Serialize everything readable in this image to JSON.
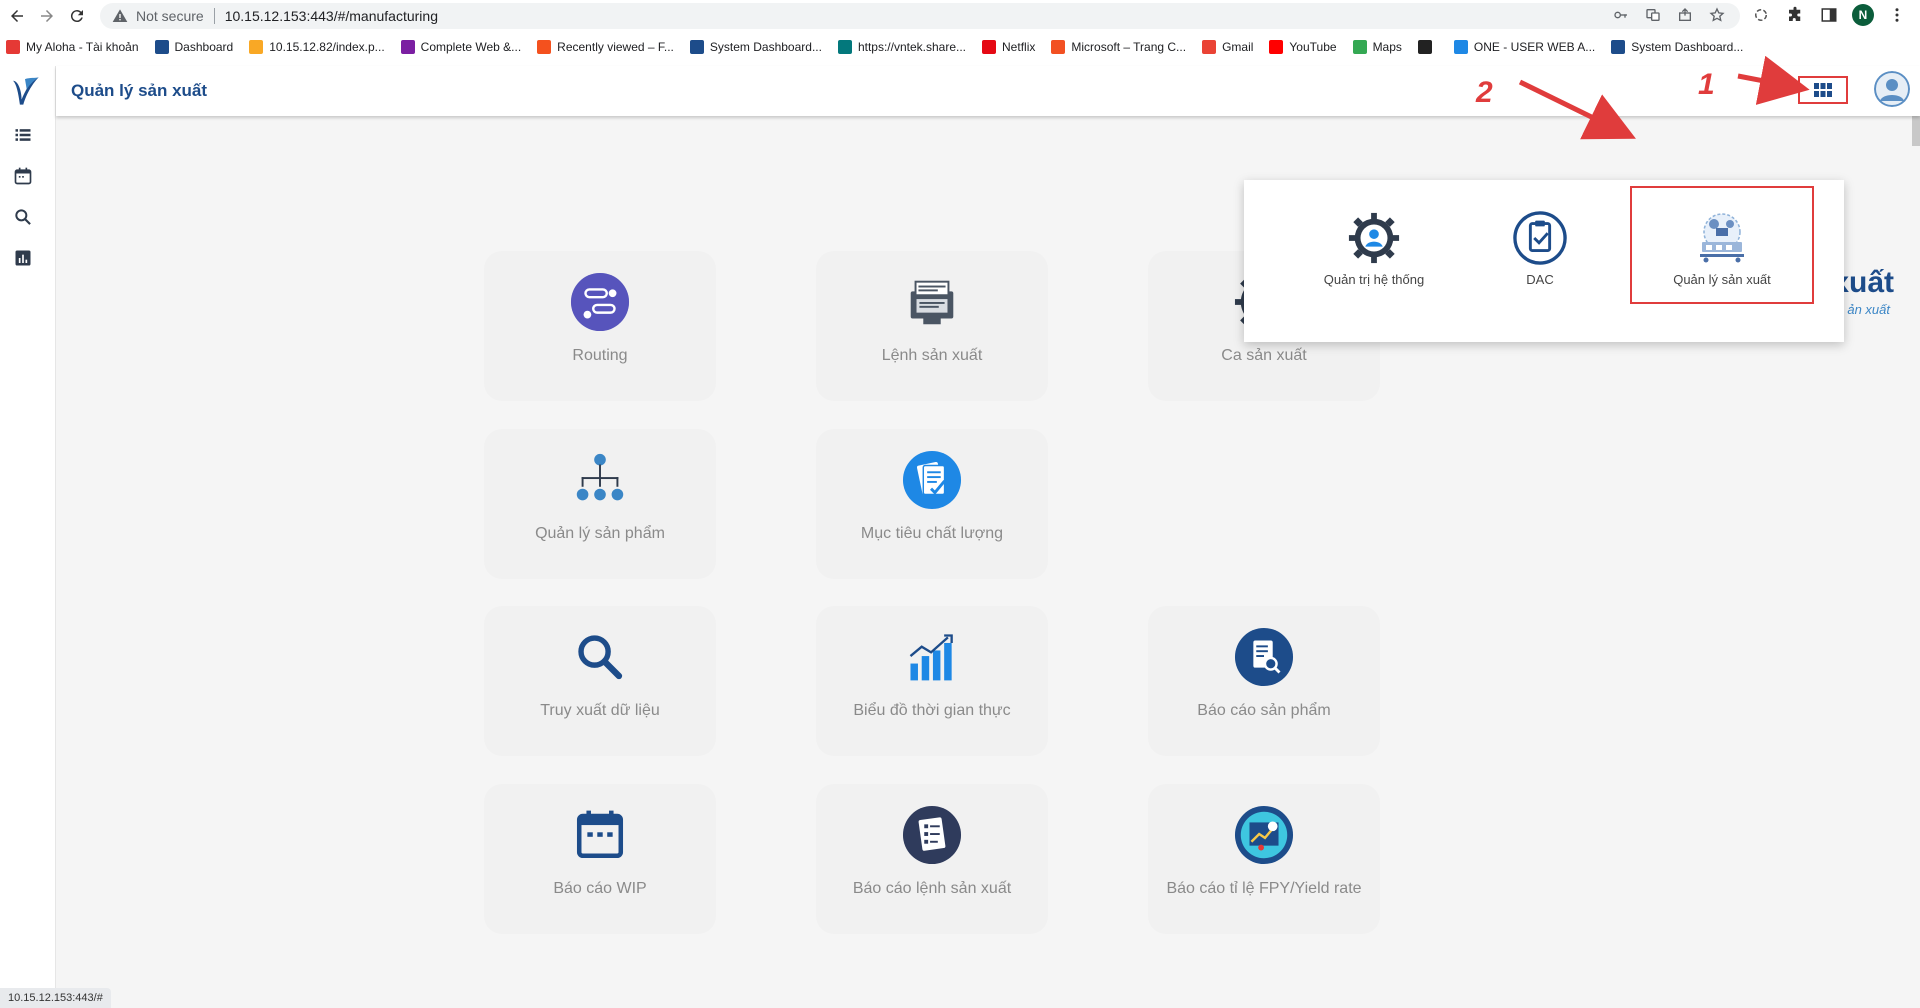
{
  "browser": {
    "not_secure": "Not secure",
    "url": "10.15.12.153:443/#/manufacturing",
    "status_url": "10.15.12.153:443/#",
    "profile_initial": "N"
  },
  "bookmarks": [
    {
      "label": "My Aloha - Tài khoản",
      "color": "#e53935"
    },
    {
      "label": "Dashboard",
      "color": "#1d4c8a"
    },
    {
      "label": "10.15.12.82/index.p...",
      "color": "#f9a825"
    },
    {
      "label": "Complete Web &...",
      "color": "#7b1fa2"
    },
    {
      "label": "Recently viewed – F...",
      "color": "#f4511e"
    },
    {
      "label": "System Dashboard...",
      "color": "#1d4c8a"
    },
    {
      "label": "https://vntek.share...",
      "color": "#03787c"
    },
    {
      "label": "Netflix",
      "color": "#e50914"
    },
    {
      "label": "Microsoft – Trang C...",
      "color": "#f25022"
    },
    {
      "label": "Gmail",
      "color": "#ea4335"
    },
    {
      "label": "YouTube",
      "color": "#ff0000"
    },
    {
      "label": "Maps",
      "color": "#34a853"
    },
    {
      "label": "",
      "color": "#222222"
    },
    {
      "label": "ONE - USER WEB A...",
      "color": "#1e88e5"
    },
    {
      "label": "System Dashboard...",
      "color": "#1d4c8a"
    }
  ],
  "header": {
    "title": "Quản lý sản xuất"
  },
  "tiles": [
    {
      "label": "Routing"
    },
    {
      "label": "Lệnh sản xuất"
    },
    {
      "label": "Ca sản xuất"
    },
    {
      "label": "Quản lý sản phẩm"
    },
    {
      "label": "Mục tiêu chất lượng"
    },
    {
      "label": "Truy xuất dữ liệu"
    },
    {
      "label": "Biểu đồ thời gian thực"
    },
    {
      "label": "Báo cáo sản phẩm"
    },
    {
      "label": "Báo cáo WIP"
    },
    {
      "label": "Báo cáo lệnh sản xuất"
    },
    {
      "label": "Báo cáo tỉ lệ FPY/Yield rate"
    }
  ],
  "app_switcher": {
    "items": [
      {
        "label": "Quản trị hệ thống"
      },
      {
        "label": "DAC"
      },
      {
        "label": "Quản lý sản xuất"
      }
    ]
  },
  "background": {
    "heading_fragment": "xuất",
    "sub_fragment": "ản xuất"
  },
  "annotations": {
    "step1": "1",
    "step2": "2",
    "color": "#e03c3c"
  },
  "colors": {
    "brand": "#1d4c8a",
    "accent": "#1e88e5",
    "tile_bg": "#f1f1f1",
    "page_bg": "#f5f5f5"
  }
}
